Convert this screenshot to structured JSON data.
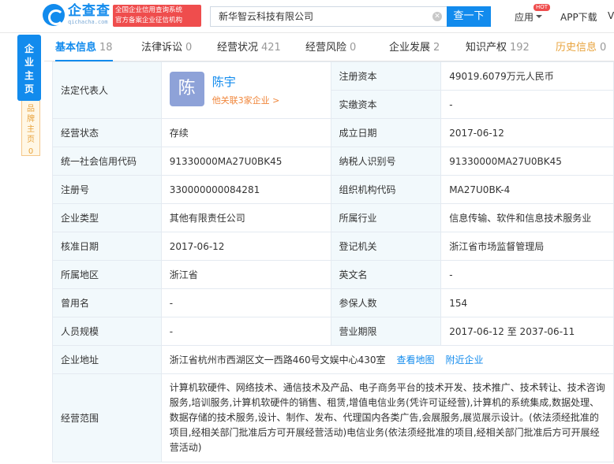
{
  "header": {
    "logo_name": "企查查",
    "logo_sub": "qichacha.com",
    "slogan_line1": "全国企业信用查询系统",
    "slogan_line2": "官方备案企业征信机构",
    "search_value": "新华智云科技有限公司",
    "search_button": "查一下",
    "nav_app": "应用",
    "hot_badge": "HOT",
    "nav_download": "APP下载",
    "nav_v": "V"
  },
  "side": {
    "main_label": "企业主页",
    "sub_label": "品牌主页",
    "sub_count": "0"
  },
  "tabs": [
    {
      "label": "基本信息",
      "count": "18"
    },
    {
      "label": "法律诉讼",
      "count": "0"
    },
    {
      "label": "经营状况",
      "count": "421"
    },
    {
      "label": "经营风险",
      "count": "0"
    },
    {
      "label": "企业发展",
      "count": "2"
    },
    {
      "label": "知识产权",
      "count": "192"
    },
    {
      "label": "历史信息",
      "count": "0"
    }
  ],
  "legal_rep": {
    "label": "法定代表人",
    "avatar_char": "陈",
    "name": "陈宇",
    "related": "他关联3家企业 >"
  },
  "fields": {
    "registered_capital": {
      "label": "注册资本",
      "value": "49019.6079万元人民币"
    },
    "paid_capital": {
      "label": "实缴资本",
      "value": "-"
    },
    "status": {
      "label": "经营状态",
      "value": "存续"
    },
    "established": {
      "label": "成立日期",
      "value": "2017-06-12"
    },
    "credit_code": {
      "label": "统一社会信用代码",
      "value": "91330000MA27U0BK45"
    },
    "tax_id": {
      "label": "纳税人识别号",
      "value": "91330000MA27U0BK45"
    },
    "reg_no": {
      "label": "注册号",
      "value": "330000000084281"
    },
    "org_code": {
      "label": "组织机构代码",
      "value": "MA27U0BK-4"
    },
    "company_type": {
      "label": "企业类型",
      "value": "其他有限责任公司"
    },
    "industry": {
      "label": "所属行业",
      "value": "信息传输、软件和信息技术服务业"
    },
    "approval_date": {
      "label": "核准日期",
      "value": "2017-06-12"
    },
    "authority": {
      "label": "登记机关",
      "value": "浙江省市场监督管理局"
    },
    "region": {
      "label": "所属地区",
      "value": "浙江省"
    },
    "english_name": {
      "label": "英文名",
      "value": "-"
    },
    "former_name": {
      "label": "曾用名",
      "value": "-"
    },
    "insured": {
      "label": "参保人数",
      "value": "154"
    },
    "staff_size": {
      "label": "人员规模",
      "value": "-"
    },
    "term": {
      "label": "营业期限",
      "value": "2017-06-12 至 2037-06-11"
    },
    "address": {
      "label": "企业地址",
      "value": "浙江省杭州市西湖区文一西路460号文娱中心430室",
      "map_link": "查看地图",
      "nearby_link": "附近企业"
    },
    "scope": {
      "label": "经营范围",
      "value": "计算机软硬件、网络技术、通信技术及产品、电子商务平台的技术开发、技术推广、技术转让、技术咨询服务,培训服务,计算机软硬件的销售、租赁,增值电信业务(凭许可证经营),计算机的系统集成,数据处理、数据存储的技术服务,设计、制作、发布、代理国内各类广告,会展服务,展览展示设计。(依法须经批准的项目,经相关部门批准后方可开展经营活动)电信业务(依法须经批准的项目,经相关部门批准后方可开展经营活动)"
    }
  }
}
